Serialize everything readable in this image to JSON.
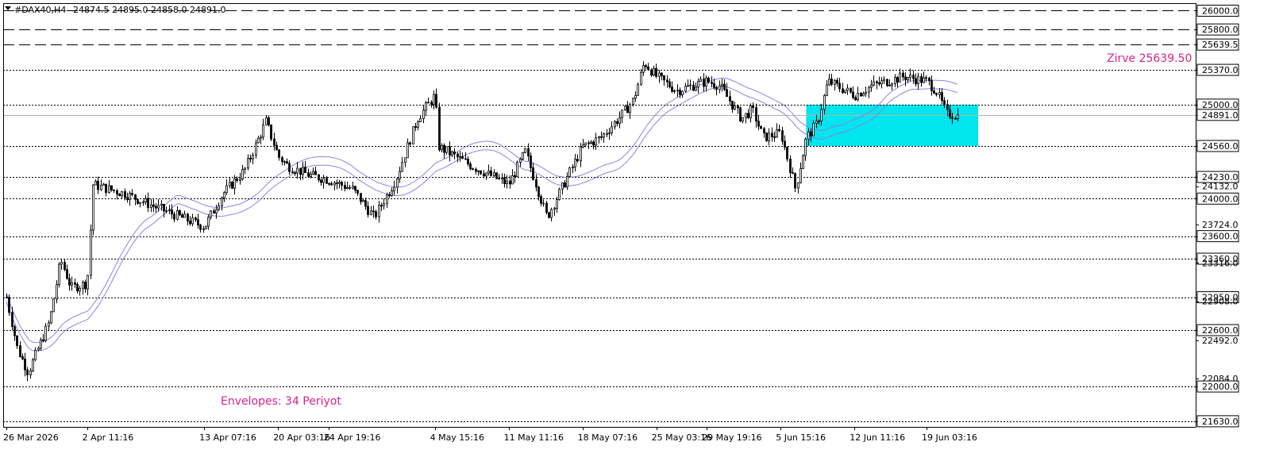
{
  "header": {
    "symbol": "#DAX40,H4",
    "ohlc": "24874.5 24895.0 24858.0 24891.0"
  },
  "annotations": {
    "peak_label": "Zirve 25639.50",
    "indicator_label": "Envelopes: 34 Periyot"
  },
  "colors": {
    "background": "#ffffff",
    "candle": "#000000",
    "envelope": "#8c82e6",
    "zone": "#00e5ee",
    "annotation": "#d6248c",
    "level_line": "#000000",
    "price_line": "#b4b4b4"
  },
  "chart_data": {
    "type": "candlestick",
    "symbol": "#DAX40",
    "timeframe": "H4",
    "ylim": [
      21570,
      26080
    ],
    "current_price": 24891.0,
    "price_axis_labels": [
      26000.0,
      25800.0,
      25639.5,
      25370.0,
      25000.0,
      24891.0,
      24560.0,
      24230.0,
      24132.0,
      24000.0,
      23724.0,
      23600.0,
      23360.0,
      23316.0,
      22950.0,
      22908.0,
      22600.0,
      22492.0,
      22084.0,
      22000.0,
      21630.0
    ],
    "x_labels": [
      "26 Mar 2026",
      "2 Apr 11:16",
      "13 Apr 07:16",
      "20 Apr 03:16",
      "24 Apr 19:16",
      "4 May 15:16",
      "11 May 11:16",
      "18 May 07:16",
      "25 May 03:16",
      "29 May 19:16",
      "5 Jun 15:16",
      "12 Jun 11:16",
      "19 Jun 03:16"
    ],
    "horizontal_levels": [
      {
        "price": 26000.0,
        "style": "longdash"
      },
      {
        "price": 25800.0,
        "style": "longdash"
      },
      {
        "price": 25639.5,
        "style": "longdash"
      },
      {
        "price": 25370.0,
        "style": "dotted"
      },
      {
        "price": 25000.0,
        "style": "dotted"
      },
      {
        "price": 24560.0,
        "style": "dotted"
      },
      {
        "price": 24230.0,
        "style": "dotted"
      },
      {
        "price": 24000.0,
        "style": "dotted"
      },
      {
        "price": 23600.0,
        "style": "dotted"
      },
      {
        "price": 23360.0,
        "style": "dotted"
      },
      {
        "price": 22950.0,
        "style": "dotted"
      },
      {
        "price": 22600.0,
        "style": "dotted"
      },
      {
        "price": 22000.0,
        "style": "dotted"
      },
      {
        "price": 21630.0,
        "style": "dotted"
      }
    ],
    "zone": {
      "top": 25000.0,
      "bottom": 24560.0,
      "start": "8 Jun 2026",
      "end": "22 Jun 2026"
    },
    "envelope": {
      "name": "Envelopes",
      "period": 34
    },
    "price_path": [
      {
        "x": "26 Mar 2026",
        "close": 22950
      },
      {
        "x": "27 Mar 2026",
        "close": 22400
      },
      {
        "x": "28 Mar 2026",
        "close": 22150
      },
      {
        "x": "30 Mar 2026",
        "close": 22700
      },
      {
        "x": "31 Mar 2026",
        "close": 23350
      },
      {
        "x": "1 Apr 2026",
        "close": 23050
      },
      {
        "x": "2 Apr 11:16",
        "close": 23100
      },
      {
        "x": "3 Apr 2026",
        "close": 24150
      },
      {
        "x": "6 Apr 2026",
        "close": 24050
      },
      {
        "x": "9 Apr 2026",
        "close": 23900
      },
      {
        "x": "13 Apr 07:16",
        "close": 23700
      },
      {
        "x": "15 Apr 2026",
        "close": 24050
      },
      {
        "x": "17 Apr 2026",
        "close": 24300
      },
      {
        "x": "19 Apr 2026",
        "close": 24820
      },
      {
        "x": "20 Apr 03:16",
        "close": 24450
      },
      {
        "x": "21 Apr 2026",
        "close": 24350
      },
      {
        "x": "23 Apr 2026",
        "close": 24250
      },
      {
        "x": "24 Apr 19:16",
        "close": 24200
      },
      {
        "x": "27 Apr 2026",
        "close": 24100
      },
      {
        "x": "29 Apr 2026",
        "close": 23800
      },
      {
        "x": "1 May 2026",
        "close": 24200
      },
      {
        "x": "3 May 2026",
        "close": 24850
      },
      {
        "x": "4 May 15:16",
        "close": 25100
      },
      {
        "x": "5 May 2026",
        "close": 24550
      },
      {
        "x": "8 May 2026",
        "close": 24350
      },
      {
        "x": "11 May 11:16",
        "close": 24150
      },
      {
        "x": "13 May 2026",
        "close": 24500
      },
      {
        "x": "15 May 2026",
        "close": 23800
      },
      {
        "x": "18 May 07:16",
        "close": 24550
      },
      {
        "x": "20 May 2026",
        "close": 24650
      },
      {
        "x": "22 May 2026",
        "close": 24900
      },
      {
        "x": "23 May 2026",
        "close": 25050
      },
      {
        "x": "24 May 2026",
        "close": 25450
      },
      {
        "x": "25 May 03:16",
        "close": 25300
      },
      {
        "x": "27 May 2026",
        "close": 25150
      },
      {
        "x": "29 May 19:16",
        "close": 25250
      },
      {
        "x": "31 May 2026",
        "close": 25200
      },
      {
        "x": "2 Jun 2026",
        "close": 24850
      },
      {
        "x": "3 Jun 2026",
        "close": 24950
      },
      {
        "x": "4 Jun 2026",
        "close": 24650
      },
      {
        "x": "5 Jun 15:16",
        "close": 24700
      },
      {
        "x": "7 Jun 2026",
        "close": 24100
      },
      {
        "x": "8 Jun 2026",
        "close": 24650
      },
      {
        "x": "9 Jun 2026",
        "close": 24800
      },
      {
        "x": "10 Jun 2026",
        "close": 25250
      },
      {
        "x": "12 Jun 11:16",
        "close": 25100
      },
      {
        "x": "14 Jun 2026",
        "close": 25200
      },
      {
        "x": "17 Jun 2026",
        "close": 25300
      },
      {
        "x": "19 Jun 03:16",
        "close": 25250
      },
      {
        "x": "20 Jun 2026",
        "close": 25150
      },
      {
        "x": "21 Jun 2026",
        "close": 24900
      },
      {
        "x": "22 Jun 2026",
        "close": 24891
      }
    ]
  }
}
